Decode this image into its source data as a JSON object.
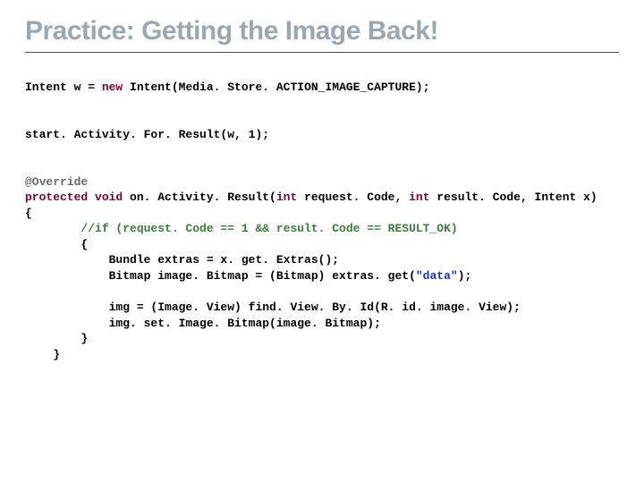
{
  "title": "Practice: Getting the Image Back!",
  "code": {
    "l1a": "Intent w = ",
    "l1kw": "new",
    "l1b": " Intent(Media. Store. ACTION_IMAGE_CAPTURE);",
    "l2": "start. Activity. For. Result(w, 1);",
    "l3ann": "@Override",
    "l4a": "protected void",
    "l4m": " on. Activity. Result",
    "l4b": "(",
    "l4kw1": "int",
    "l4c": " request. Code, ",
    "l4kw2": "int",
    "l4d": " result. Code, Intent x)",
    "l5": "{",
    "l6cmt": "        //if (request. Code == 1 && result. Code == RESULT_OK)",
    "l7": "        {",
    "l8": "            Bundle extras = x. get. Extras();",
    "l9a": "            Bitmap image. Bitmap = (Bitmap) extras. get(",
    "l9str": "\"data\"",
    "l9b": ");",
    "l10": "            img = (Image. View) find. View. By. Id(R. id. image. View);",
    "l11": "            img. set. Image. Bitmap(image. Bitmap);",
    "l12": "        }",
    "l13": "    }"
  }
}
